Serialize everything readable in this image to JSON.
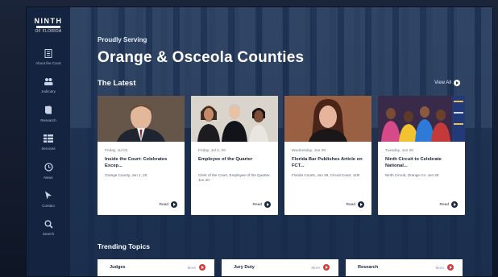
{
  "sidebar": {
    "logo_top": "NINTH",
    "logo_bottom": "OF FLORIDA",
    "items": [
      {
        "label": "About the Court",
        "icon": "building-icon"
      },
      {
        "label": "Judiciary",
        "icon": "people-icon"
      },
      {
        "label": "Research",
        "icon": "book-icon"
      },
      {
        "label": "Services",
        "icon": "grid-icon"
      },
      {
        "label": "News",
        "icon": "clock-icon"
      },
      {
        "label": "Contact",
        "icon": "cursor-icon"
      },
      {
        "label": "Search",
        "icon": "search-icon"
      }
    ]
  },
  "hero": {
    "eyebrow": "Proudly Serving",
    "headline": "Orange & Osceola Counties"
  },
  "latest": {
    "title": "The Latest",
    "view_all": "View All",
    "cards": [
      {
        "date": "Friday, Jul 01",
        "title": "Inside the Court: Celebrates Excep...",
        "excerpt": "Orange County, Jun 1, 20",
        "read": "Read"
      },
      {
        "date": "Friday, Jul 1, 20",
        "title": "Employee of the Quarter",
        "excerpt": "Clerk of the Court, Employee of the Quarter, Jun 20",
        "read": "Read"
      },
      {
        "date": "Wednesday, Jun 29",
        "title": "Florida Bar Publishes Article on FCT...",
        "excerpt": "Florida Courts, Jun 29, Circuit Court, 11th",
        "read": "Read"
      },
      {
        "date": "Tuesday, Jun 28",
        "title": "Ninth Circuit to Celebrate National...",
        "excerpt": "Ninth Circuit, Orange Co. Jun 28",
        "read": "Read"
      }
    ]
  },
  "trending": {
    "title": "Trending Topics",
    "topics": [
      {
        "label": "Judges",
        "more": "More"
      },
      {
        "label": "Jury Duty",
        "more": "More"
      },
      {
        "label": "Research",
        "more": "More"
      }
    ]
  },
  "colors": {
    "sidebar_bg": "#14233f",
    "accent_red": "#d73a3a",
    "text_dark": "#1b2336"
  }
}
